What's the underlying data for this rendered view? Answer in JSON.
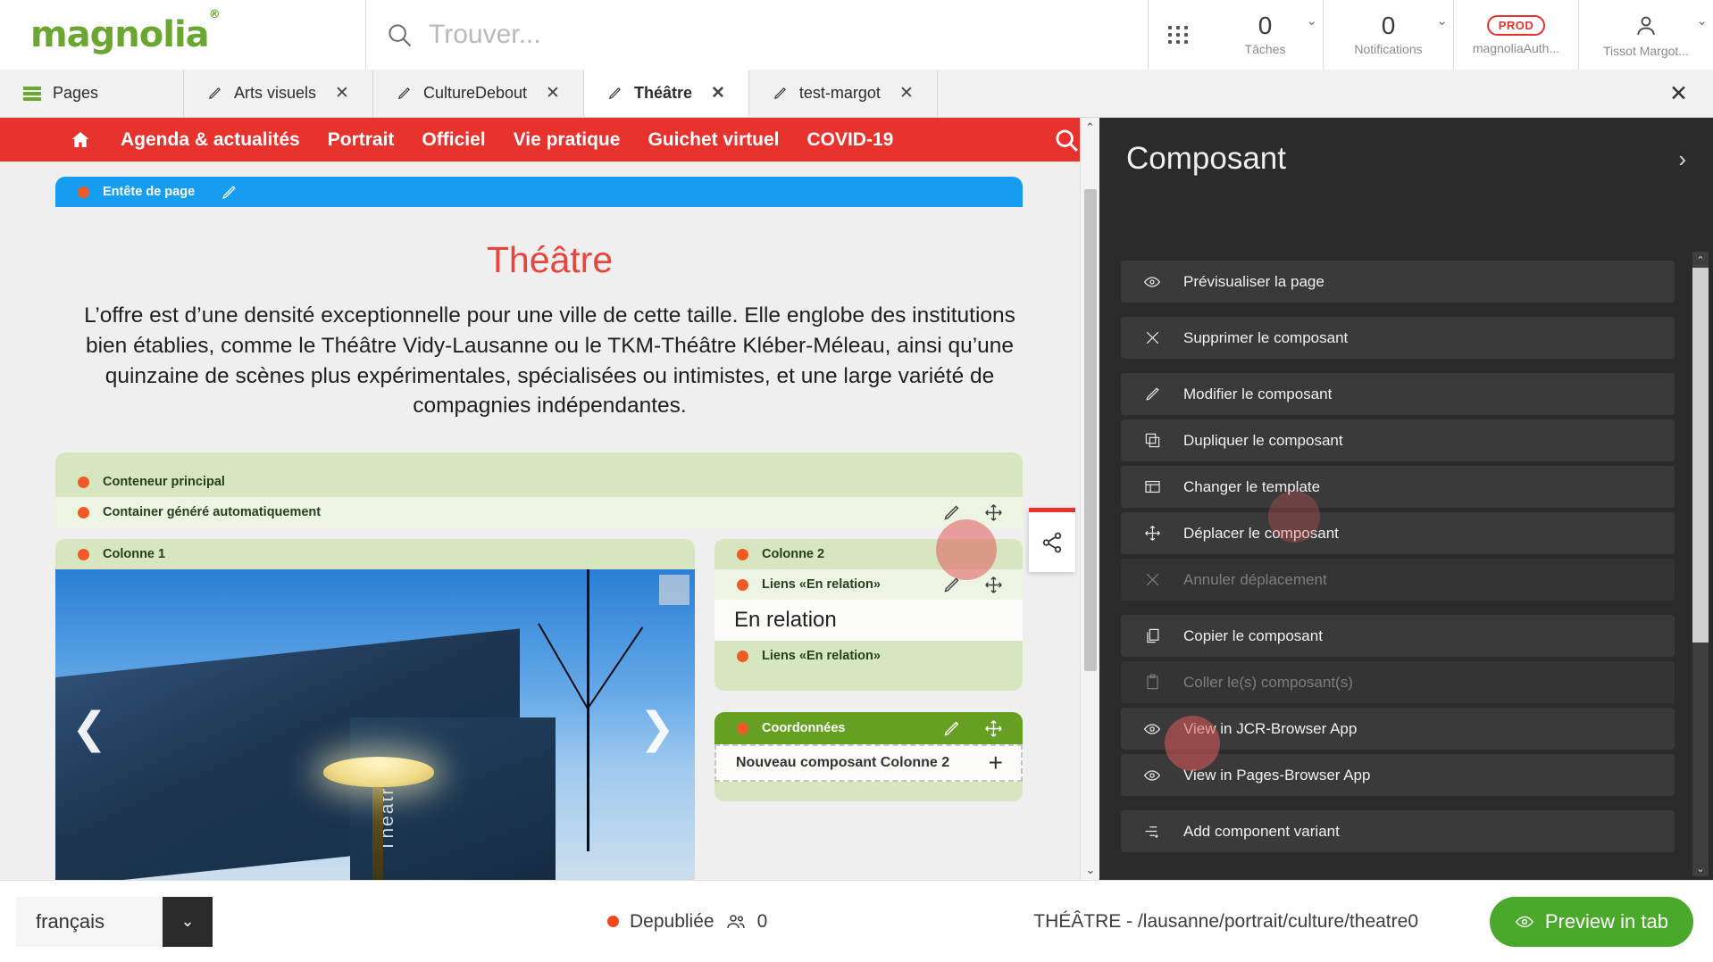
{
  "header": {
    "logo": "magnolia",
    "logo_mark": "®",
    "search_placeholder": "Trouver...",
    "apps_icon": "apps-grid-icon",
    "tasks": {
      "count": "0",
      "label": "Tâches"
    },
    "notifications": {
      "count": "0",
      "label": "Notifications"
    },
    "instance": {
      "badge": "PROD",
      "label": "magnoliaAuth..."
    },
    "user": {
      "label": "Tissot Margot..."
    }
  },
  "tabs": {
    "pages_label": "Pages",
    "items": [
      {
        "label": "Arts visuels",
        "active": false
      },
      {
        "label": "CultureDebout",
        "active": false
      },
      {
        "label": "Théâtre",
        "active": true
      },
      {
        "label": "test-margot",
        "active": false
      }
    ],
    "close_all": "✕"
  },
  "site_nav": {
    "home": "home-icon",
    "links": [
      "Agenda & actualités",
      "Portrait",
      "Officiel",
      "Vie pratique",
      "Guichet virtuel",
      "COVID-19"
    ],
    "search_icon": "search-icon"
  },
  "stage": {
    "entete_label": "Entête de page",
    "page_title": "Théâtre",
    "page_intro": "L’offre est d’une densité exceptionnelle pour une ville de cette taille. Elle englobe des institutions bien établies, comme le Théâtre Vidy-Lausanne ou le TKM-Théâtre Kléber-Méleau, ainsi qu’une quinzaine de scènes plus expérimentales, spécialisées ou intimistes, et une large variété de compagnies indépendantes.",
    "container_main": "Conteneur principal",
    "container_auto": "Container généré automatiquement",
    "colonne1": "Colonne 1",
    "colonne2": "Colonne 2",
    "liens_relation": "Liens «En relation»",
    "liens_relation2": "Liens «En relation»",
    "relation_text": "En relation",
    "coordonnees": "Coordonnées",
    "new_component": "Nouveau composant Colonne 2",
    "new_component_plus": "+",
    "photo_caption": "Théâtre",
    "arrow_prev": "❮",
    "arrow_next": "❯"
  },
  "right_panel": {
    "title": "Composant",
    "collapse_icon": "chevron-right-icon",
    "actions": [
      {
        "label": "Prévisualiser la page",
        "icon": "preview-eye-icon",
        "disabled": false,
        "gap": false
      },
      {
        "label": "Supprimer le composant",
        "icon": "close-x-icon",
        "disabled": false,
        "gap": true
      },
      {
        "label": "Modifier le composant",
        "icon": "pencil-icon",
        "disabled": false,
        "gap": true
      },
      {
        "label": "Dupliquer le composant",
        "icon": "duplicate-icon",
        "disabled": false,
        "gap": false
      },
      {
        "label": "Changer le template",
        "icon": "template-icon",
        "disabled": false,
        "gap": false
      },
      {
        "label": "Déplacer le composant",
        "icon": "move-icon",
        "disabled": false,
        "gap": false
      },
      {
        "label": "Annuler déplacement",
        "icon": "close-x-icon",
        "disabled": true,
        "gap": false
      },
      {
        "label": "Copier le composant",
        "icon": "copy-icon",
        "disabled": false,
        "gap": true
      },
      {
        "label": "Coller le(s) composant(s)",
        "icon": "paste-icon",
        "disabled": true,
        "gap": false
      },
      {
        "label": "View in JCR-Browser App",
        "icon": "eye-icon",
        "disabled": false,
        "gap": false
      },
      {
        "label": "View in Pages-Browser App",
        "icon": "eye-icon",
        "disabled": false,
        "gap": false
      },
      {
        "label": "Add component variant",
        "icon": "add-variant-icon",
        "disabled": false,
        "gap": true
      }
    ]
  },
  "bottom": {
    "language": "français",
    "status": "Depubliée",
    "users_count": "0",
    "path": "THÉÂTRE - /lausanne/portrait/culture/theatre0",
    "preview_button": "Preview in tab"
  },
  "colors": {
    "brand_green": "#6aa630",
    "site_red": "#e8322d",
    "entete_blue": "#169df0",
    "container_green": "#d7e6c1",
    "coord_green": "#66a022",
    "panel_dark": "#2b2b2b",
    "preview_green": "#4aa82a",
    "status_orange": "#f1471d"
  }
}
